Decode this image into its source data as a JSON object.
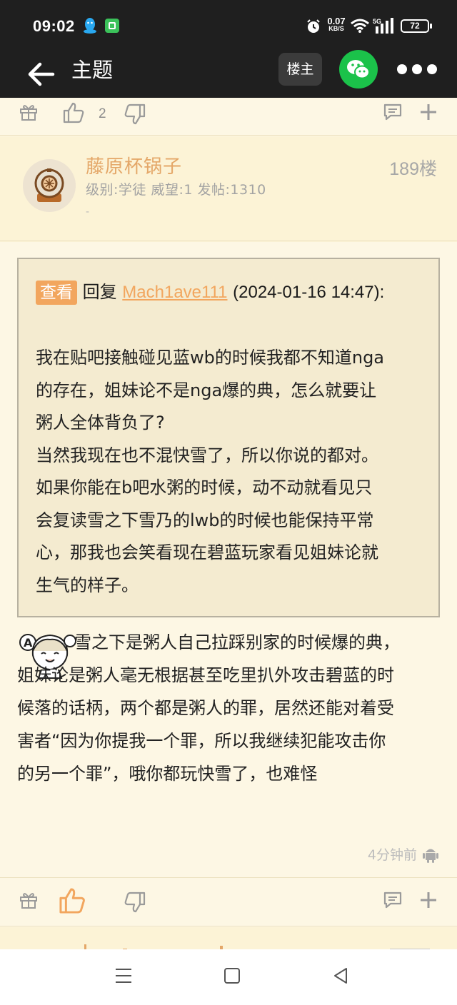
{
  "status": {
    "time": "09:02",
    "net_speed_value": "0.07",
    "net_speed_unit": "KB/S",
    "network_type": "5G",
    "battery": "72"
  },
  "appbar": {
    "title": "主题",
    "owner_filter": "楼主",
    "icons": [
      "back-arrow-icon",
      "wechat-icon",
      "more-icon"
    ]
  },
  "prev_post_actions": {
    "like_count": "2"
  },
  "post": {
    "username": "藤原杯锅子",
    "floor": "189楼",
    "meta": "级别:学徒 威望:1 发帖:1310",
    "meta_extra": "-",
    "quote": {
      "badge": "查看",
      "reply_word": "回复",
      "quoted_user": "Mach1ave111",
      "quoted_time": "(2024-01-16 14:47):",
      "lines": [
        "我在贴吧接触碰见蓝wb的时候我都不知道nga",
        "的存在，姐妹论不是nga爆的典，怎么就要让",
        "粥人全体背负了?",
        "当然我现在也不混快雪了，所以你说的都对。",
        "如果你能在b吧水粥的时候，动不动就看见只",
        "会复读雪之下雪乃的lwb的时候也能保持平常",
        "心，那我也会笑看现在碧蓝玩家看见姐妹论就",
        "生气的样子。"
      ]
    },
    "reply_lines": [
      "雪之下是粥人自己拉踩别家的时候爆的典，",
      "姐妹论是粥人毫无根据甚至吃里扒外攻击碧蓝的时",
      "候落的话柄，两个都是粥人的罪，居然还能对着受",
      "害者“因为你提我一个罪，所以我继续犯能攻击你",
      "的另一个罪”，哦你都玩快雪了，也难怪"
    ],
    "posted_ago": "4分钟前"
  },
  "colors": {
    "dark_bar": "#1f1f1f",
    "background": "#fdf7e4",
    "accent_orange": "#f2a65e",
    "username": "#e4a768",
    "wechat_green": "#1bc24a"
  }
}
